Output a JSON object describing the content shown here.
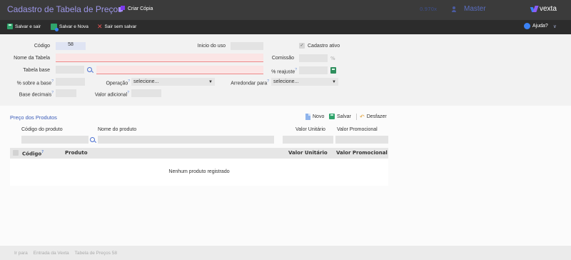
{
  "header": {
    "title": "Cadastro de Tabela de Preços",
    "copy_label": "Criar Cópia",
    "version": "0.970x",
    "user": "Master",
    "logo": "vexta"
  },
  "toolbar": {
    "save_exit": "Salvar e sair",
    "save_new": "Salvar e Nova",
    "exit_nosave": "Sair sem salvar",
    "help": "Ajuda?"
  },
  "form": {
    "codigo_label": "Código",
    "codigo_value": "58",
    "inicio_label": "Inicio do uso",
    "inicio_value": "",
    "ativo_label": "Cadastro ativo",
    "ativo_check": "✓",
    "nome_label": "Nome da Tabela",
    "nome_value": "",
    "comissao_label": "Comissão",
    "comissao_value": "",
    "percent": "%",
    "base_label": "Tabela base",
    "base_code": "",
    "base_name": "",
    "reajuste_label": "% reajuste",
    "reajuste_value": "",
    "sobre_label": "% sobre a base",
    "sobre_value": "",
    "operacao_label": "Operação",
    "operacao_value": "selecione...",
    "arredondar_label": "Arredondar para",
    "arredondar_value": "selecione...",
    "decimais_label": "Base decimais",
    "decimais_value": "",
    "adicional_label": "Valor adicional",
    "adicional_value": "",
    "help_mark": "?"
  },
  "produtos": {
    "title": "Preço dos Produtos",
    "novo": "Novo",
    "salvar": "Salvar",
    "desfazer": "Desfazer",
    "filter_codigo": "Código do produto",
    "filter_nome": "Nome do produto",
    "filter_valor": "Valor Unitário",
    "filter_promo": "Valor Promocional",
    "col_codigo": "Código",
    "col_produto": "Produto",
    "col_valor": "Valor Unitário",
    "col_promo": "Valor Promocional",
    "empty": "Nenhum produto registrado"
  },
  "footer": {
    "items": [
      "Ir para",
      "Entrada da Vexta",
      "Tabela de Preços 58"
    ]
  }
}
